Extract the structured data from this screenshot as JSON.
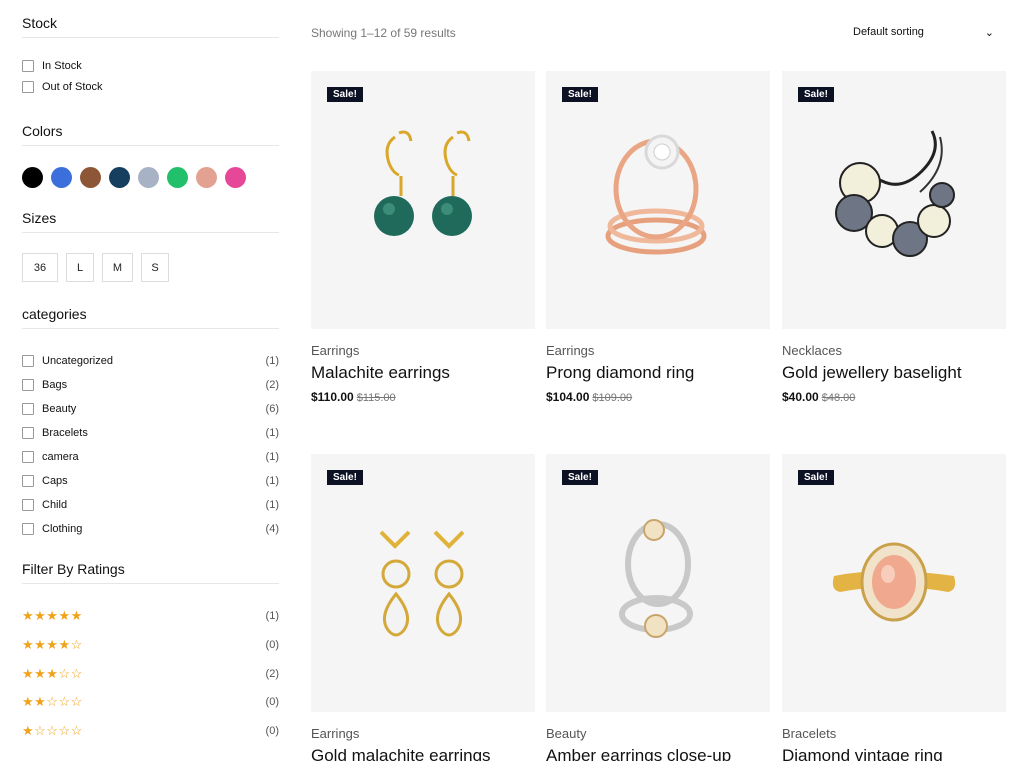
{
  "sidebar": {
    "stock": {
      "title": "Stock",
      "options": [
        "In Stock",
        "Out of Stock"
      ]
    },
    "colors": {
      "title": "Colors",
      "swatches": [
        "#000000",
        "#3b6fdc",
        "#8d5637",
        "#163e5e",
        "#a8b2c5",
        "#22c06a",
        "#e3a191",
        "#e64796"
      ]
    },
    "sizes": {
      "title": "Sizes",
      "options": [
        "36",
        "L",
        "M",
        "S"
      ]
    },
    "categories": {
      "title": "categories",
      "items": [
        {
          "name": "Uncategorized",
          "count": "(1)"
        },
        {
          "name": "Bags",
          "count": "(2)"
        },
        {
          "name": "Beauty",
          "count": "(6)"
        },
        {
          "name": "Bracelets",
          "count": "(1)"
        },
        {
          "name": "camera",
          "count": "(1)"
        },
        {
          "name": "Caps",
          "count": "(1)"
        },
        {
          "name": "Child",
          "count": "(1)"
        },
        {
          "name": "Clothing",
          "count": "(4)"
        }
      ]
    },
    "ratings": {
      "title": "Filter By Ratings",
      "items": [
        {
          "stars": "★★★★★",
          "count": "(1)"
        },
        {
          "stars": "★★★★☆",
          "count": "(0)"
        },
        {
          "stars": "★★★☆☆",
          "count": "(2)"
        },
        {
          "stars": "★★☆☆☆",
          "count": "(0)"
        },
        {
          "stars": "★☆☆☆☆",
          "count": "(0)"
        }
      ]
    }
  },
  "toolbar": {
    "result_count": "Showing 1–12 of 59 results",
    "sorting": "Default sorting",
    "sorting_icon": "chevron-down-icon"
  },
  "products": [
    {
      "badge": "Sale!",
      "category": "Earrings",
      "title": "Malachite earrings",
      "price": "$110.00",
      "old_price": "$115.00",
      "image": "malachite-earrings"
    },
    {
      "badge": "Sale!",
      "category": "Earrings",
      "title": "Prong diamond ring",
      "price": "$104.00",
      "old_price": "$109.00",
      "image": "rose-gold-rings"
    },
    {
      "badge": "Sale!",
      "category": "Necklaces",
      "title": "Gold jewellery baselight",
      "price": "$40.00",
      "old_price": "$48.00",
      "image": "link-bracelet"
    },
    {
      "badge": "Sale!",
      "category": "Earrings",
      "title": "Gold malachite earrings",
      "price": "",
      "old_price": "",
      "image": "crystal-drop-earrings"
    },
    {
      "badge": "Sale!",
      "category": "Beauty",
      "title": "Amber earrings close-up",
      "price": "",
      "old_price": "",
      "image": "silver-rings"
    },
    {
      "badge": "Sale!",
      "category": "Bracelets",
      "title": "Diamond vintage ring",
      "price": "",
      "old_price": "",
      "image": "peach-gem-ring"
    }
  ]
}
